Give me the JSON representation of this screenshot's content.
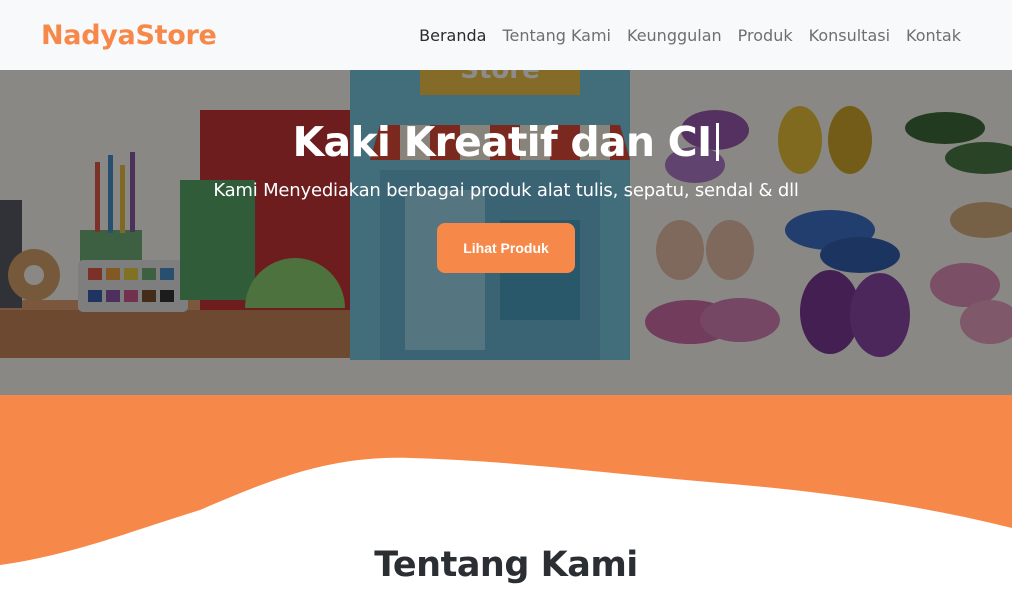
{
  "brand": "NadyaStore",
  "nav": {
    "items": [
      {
        "label": "Beranda"
      },
      {
        "label": "Tentang Kami"
      },
      {
        "label": "Keunggulan"
      },
      {
        "label": "Produk"
      },
      {
        "label": "Konsultasi"
      },
      {
        "label": "Kontak"
      }
    ]
  },
  "hero": {
    "title": "Kaki Kreatif dan CI",
    "subtitle": "Kami Menyediakan berbagai produk alat tulis, sepatu, sendal & dll",
    "button_label": "Lihat Produk",
    "store_sign": "Store"
  },
  "about": {
    "title": "Tentang Kami"
  },
  "colors": {
    "accent": "#f6894a",
    "navbar_bg": "#f8f9fa",
    "title_text": "#2b2f33"
  }
}
